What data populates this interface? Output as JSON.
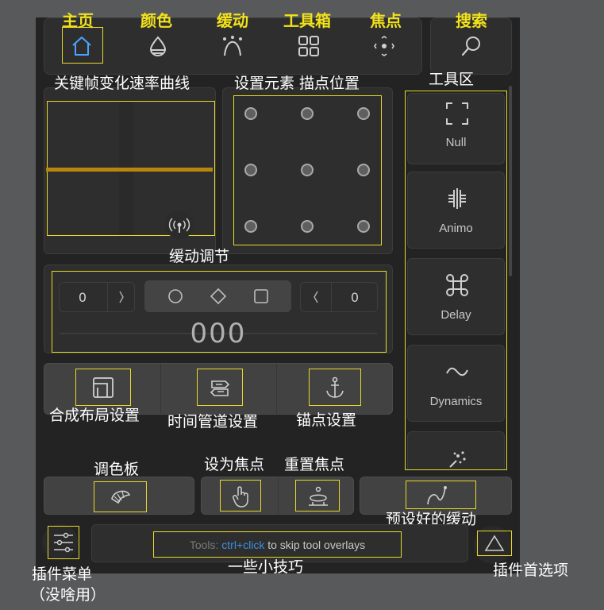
{
  "nav": {
    "home": "主页",
    "color": "颜色",
    "ease": "缓动",
    "toolbox": "工具箱",
    "focus": "焦点",
    "search": "搜索"
  },
  "labels": {
    "keyframe_curve": "关键帧变化速率曲线",
    "anchor_position": "设置元素 描点位置",
    "tool_area": "工具区",
    "ease_adjust": "缓动调节",
    "compose_layout": "合成布局设置",
    "time_pipeline": "时间管道设置",
    "anchor_set": "锚点设置",
    "palette": "调色板",
    "set_focus": "设为焦点",
    "reset_focus": "重置焦点",
    "preset_ease": "预设好的缓动",
    "plugin_menu_line1": "插件菜单",
    "plugin_menu_line2": "（没啥用）",
    "tips": "一些小技巧",
    "plugin_prefs": "插件首选项"
  },
  "tools": [
    {
      "name": "Null",
      "icon": "null-icon"
    },
    {
      "name": "Animo",
      "icon": "animo-icon"
    },
    {
      "name": "Delay",
      "icon": "command-icon"
    },
    {
      "name": "Dynamics",
      "icon": "wave-icon"
    },
    {
      "name": "",
      "icon": "sparkle-icon"
    }
  ],
  "ease": {
    "left_value": "0",
    "right_value": "0",
    "big_value": "000"
  },
  "tip": {
    "prefix": "Tools: ",
    "shortcut": "ctrl+click",
    "suffix": " to skip tool overlays"
  },
  "colors": {
    "annotation": "#e8d92a",
    "curve": "#b8860b",
    "link": "#3d8fe0"
  }
}
